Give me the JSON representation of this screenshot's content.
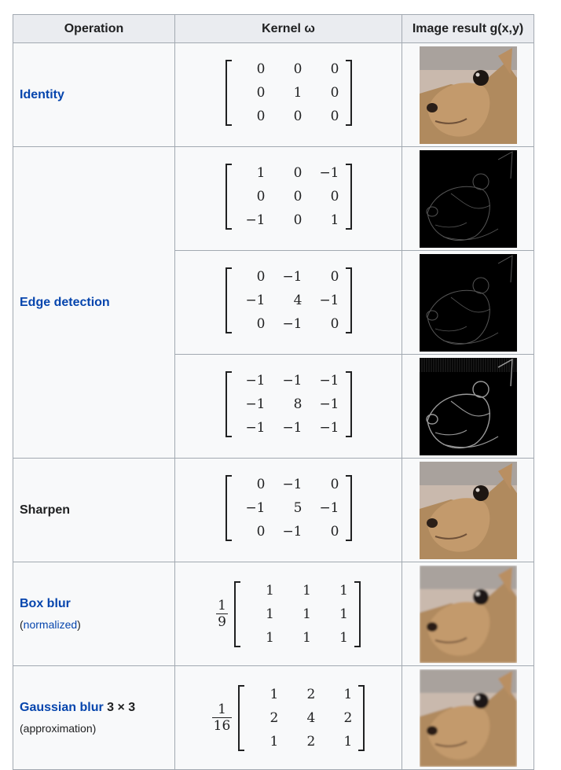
{
  "headers": {
    "operation": "Operation",
    "kernel": "Kernel ω",
    "result": "Image result g(x,y)"
  },
  "rows": {
    "identity": {
      "label": "Identity",
      "matrix": [
        "0",
        "0",
        "0",
        "0",
        "1",
        "0",
        "0",
        "0",
        "0"
      ]
    },
    "edge": {
      "label": "Edge detection",
      "m1": [
        "1",
        "0",
        "−1",
        "0",
        "0",
        "0",
        "−1",
        "0",
        "1"
      ],
      "m2": [
        "0",
        "−1",
        "0",
        "−1",
        "4",
        "−1",
        "0",
        "−1",
        "0"
      ],
      "m3": [
        "−1",
        "−1",
        "−1",
        "−1",
        "8",
        "−1",
        "−1",
        "−1",
        "−1"
      ]
    },
    "sharpen": {
      "label": "Sharpen",
      "matrix": [
        "0",
        "−1",
        "0",
        "−1",
        "5",
        "−1",
        "0",
        "−1",
        "0"
      ]
    },
    "boxblur": {
      "label": "Box blur",
      "note_open": "(",
      "note_link": "normalized",
      "note_close": ")",
      "frac_num": "1",
      "frac_den": "9",
      "matrix": [
        "1",
        "1",
        "1",
        "1",
        "1",
        "1",
        "1",
        "1",
        "1"
      ]
    },
    "gaussian": {
      "label": "Gaussian blur",
      "size": "3 × 3",
      "note": "(approximation)",
      "frac_num": "1",
      "frac_den": "16",
      "matrix": [
        "1",
        "2",
        "1",
        "2",
        "4",
        "2",
        "1",
        "2",
        "1"
      ]
    }
  },
  "image_styles": {
    "normal": "color-photo-squirrel",
    "edge": "dark-edge-map"
  }
}
